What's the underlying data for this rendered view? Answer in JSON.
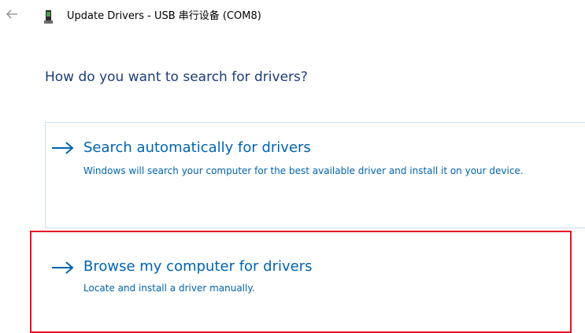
{
  "window": {
    "title": "Update Drivers - USB 串行设备 (COM8)",
    "back_icon": "back-arrow-icon",
    "device_icon": "usb-device-icon"
  },
  "main": {
    "heading": "How do you want to search for drivers?",
    "options": [
      {
        "title": "Search automatically for drivers",
        "description": "Windows will search your computer for the best available driver and install it on your device.",
        "icon": "arrow-right-icon"
      },
      {
        "title": "Browse my computer for drivers",
        "description": "Locate and install a driver manually.",
        "icon": "arrow-right-icon"
      }
    ]
  },
  "colors": {
    "link": "#0063b1",
    "heading": "#1c3d7a",
    "highlight": "#e81123",
    "option_border": "#cce0f2"
  }
}
